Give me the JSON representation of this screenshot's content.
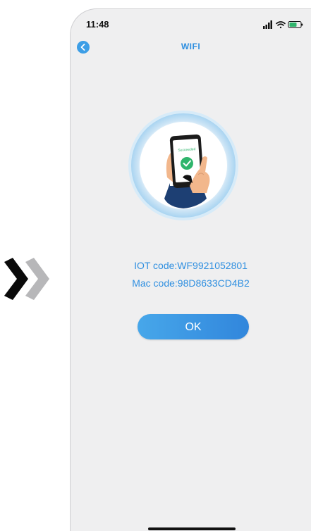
{
  "status_bar": {
    "time": "11:48",
    "icons": [
      "signal-icon",
      "wifi-icon",
      "battery-icon"
    ]
  },
  "nav": {
    "back_icon": "chevron-left-icon",
    "title": "WIFI"
  },
  "illustration": {
    "label": "Succeeded",
    "icon": "checkmark-icon"
  },
  "device": {
    "iot_code": "IOT code:WF9921052801",
    "mac_code": "Mac code:98D8633CD4B2"
  },
  "actions": {
    "ok_label": "OK"
  },
  "colors": {
    "accent": "#2f8fe0",
    "background": "#efeff0",
    "success": "#2fb56c"
  }
}
